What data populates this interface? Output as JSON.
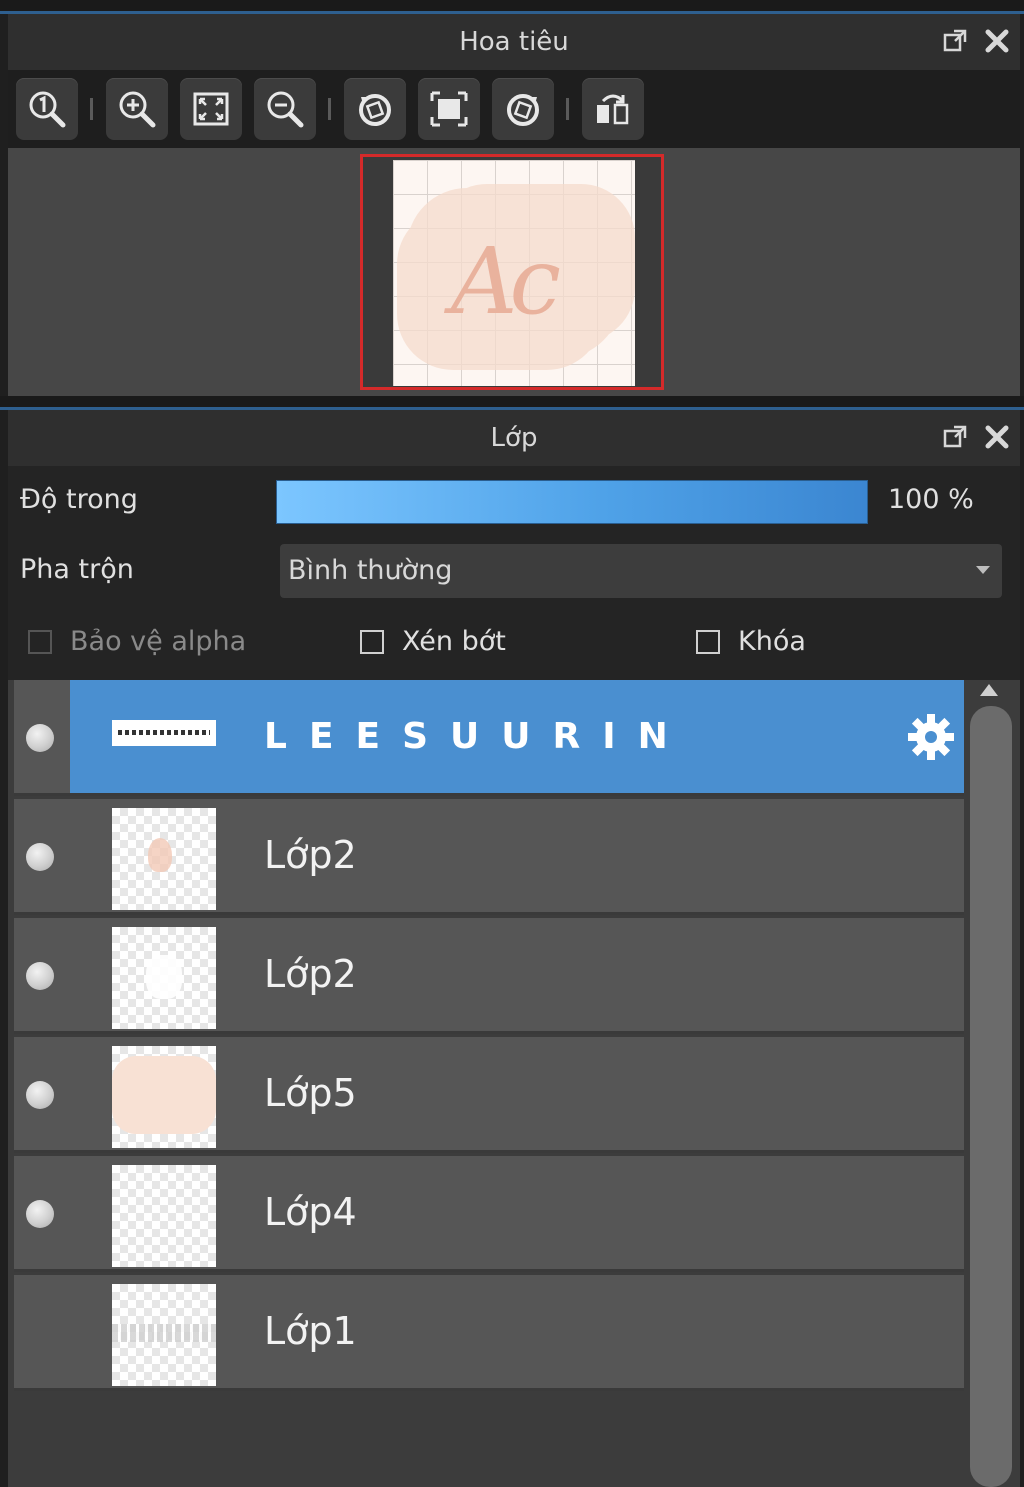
{
  "navigator": {
    "title": "Hoa tiêu",
    "header_icons": [
      "popout-icon",
      "close-icon"
    ],
    "tools": [
      {
        "name": "actual-size-icon"
      },
      {
        "name": "zoom-in-icon"
      },
      {
        "name": "fit-screen-icon"
      },
      {
        "name": "zoom-out-icon"
      },
      {
        "name": "rotate-left-icon"
      },
      {
        "name": "fit-window-icon"
      },
      {
        "name": "rotate-right-icon"
      },
      {
        "name": "flip-horizontal-icon"
      }
    ],
    "preview_border_color": "#d42a2a"
  },
  "layers_panel": {
    "title": "Lớp",
    "opacity_label": "Độ trong",
    "opacity_value": "100 %",
    "opacity_fraction": 1.0,
    "blend_label": "Pha trộn",
    "blend_value": "Bình thường",
    "checkboxes": [
      {
        "label": "Bảo vệ alpha",
        "checked": false,
        "disabled": true
      },
      {
        "label": "Xén bớt",
        "checked": false,
        "disabled": false
      },
      {
        "label": "Khóa",
        "checked": false,
        "disabled": false
      }
    ],
    "layers": [
      {
        "name": "LEESUURIN",
        "selected": true,
        "visible": true
      },
      {
        "name": "Lớp2",
        "selected": false,
        "visible": true
      },
      {
        "name": "Lớp2",
        "selected": false,
        "visible": true
      },
      {
        "name": "Lớp5",
        "selected": false,
        "visible": true
      },
      {
        "name": "Lớp4",
        "selected": false,
        "visible": true
      },
      {
        "name": "Lớp1",
        "selected": false,
        "visible": false
      }
    ],
    "selected_color": "#4a8fd0"
  }
}
